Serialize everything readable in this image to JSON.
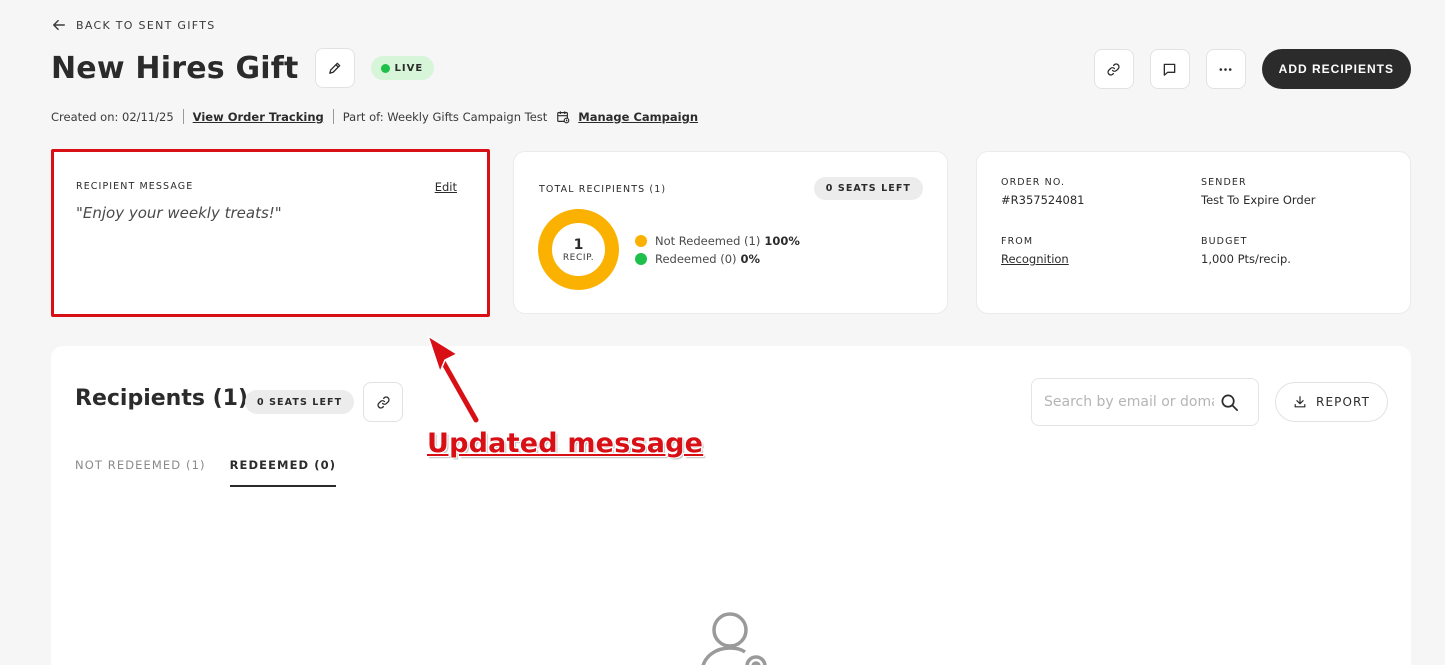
{
  "nav": {
    "back_label": "BACK TO SENT GIFTS"
  },
  "header": {
    "title": "New Hires Gift",
    "status": "LIVE",
    "add_recipients_label": "ADD RECIPIENTS"
  },
  "meta": {
    "created": "Created on: 02/11/25",
    "order_tracking_label": "View Order Tracking",
    "part_of": "Part of: Weekly Gifts Campaign Test",
    "manage_campaign_label": "Manage Campaign"
  },
  "message_card": {
    "label": "RECIPIENT MESSAGE",
    "edit_label": "Edit",
    "message": "\"Enjoy your weekly treats!\""
  },
  "recipients_card": {
    "label": "TOTAL RECIPIENTS (1)",
    "seats": "0 SEATS LEFT",
    "donut_count": "1",
    "donut_unit": "RECIP.",
    "legend": [
      {
        "label": "Not Redeemed (1)",
        "pct": "100%",
        "color": "#fbb100"
      },
      {
        "label": "Redeemed (0)",
        "pct": "0%",
        "color": "#1fbf4b"
      }
    ]
  },
  "order_card": {
    "order_label": "ORDER NO.",
    "order_value": "#R357524081",
    "sender_label": "SENDER",
    "sender_value": "Test To Expire Order",
    "from_label": "FROM",
    "from_value": "Recognition",
    "budget_label": "BUDGET",
    "budget_value": "1,000 Pts/recip."
  },
  "recipients_section": {
    "title": "Recipients (1)",
    "seats": "0 SEATS LEFT",
    "search_placeholder": "Search by email or domain",
    "report_label": "REPORT",
    "tabs": [
      {
        "label": "NOT REDEEMED (1)"
      },
      {
        "label": "REDEEMED (0)"
      }
    ]
  },
  "annotation": {
    "text": "Updated message",
    "color": "#d90f16"
  }
}
